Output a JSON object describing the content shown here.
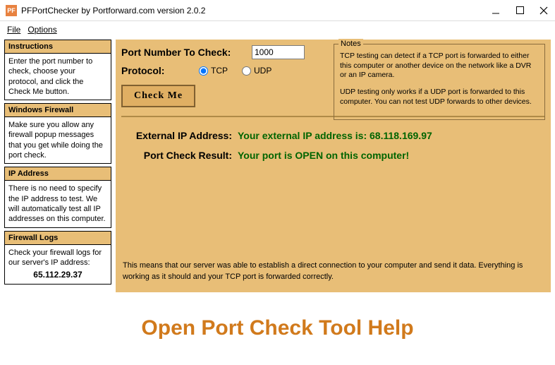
{
  "titlebar": {
    "title": "PFPortChecker by Portforward.com version 2.0.2",
    "icon_text": "PF"
  },
  "menu": {
    "file": "File",
    "options": "Options"
  },
  "sidebar": {
    "instructions": {
      "head": "Instructions",
      "body": "Enter the port number to check, choose your protocol, and click the Check Me button."
    },
    "firewall": {
      "head": "Windows Firewall",
      "body": "Make sure you allow any firewall popup messages that you get while doing the port check."
    },
    "ip": {
      "head": "IP Address",
      "body": "There is no need to specify the IP address to test. We will automatically test all IP addresses on this computer."
    },
    "logs": {
      "head": "Firewall Logs",
      "body": "Check your firewall logs for our server's IP address:",
      "server_ip": "65.112.29.37"
    }
  },
  "main": {
    "port_label": "Port Number To Check:",
    "port_value": "1000",
    "protocol_label": "Protocol:",
    "tcp_label": "TCP",
    "udp_label": "UDP",
    "protocol_selected": "tcp",
    "check_btn": "Check Me",
    "notes": {
      "legend": "Notes",
      "p1": "TCP testing can detect if a TCP port is forwarded to either this computer or another device on the network like a DVR or an IP camera.",
      "p2": "UDP testing only works if a UDP port is forwarded to this computer. You can not test UDP forwards to other devices."
    },
    "ext_ip_label": "External IP Address:",
    "ext_ip_value": "Your external IP address is: 68.118.169.97",
    "result_label": "Port Check Result:",
    "result_value": "Your port is OPEN on this computer!",
    "footnote": "This means that our server was able to establish a direct connection to your computer and send it data. Everything is working as it should and your TCP port is forwarded correctly."
  },
  "big_title": "Open Port Check Tool Help"
}
